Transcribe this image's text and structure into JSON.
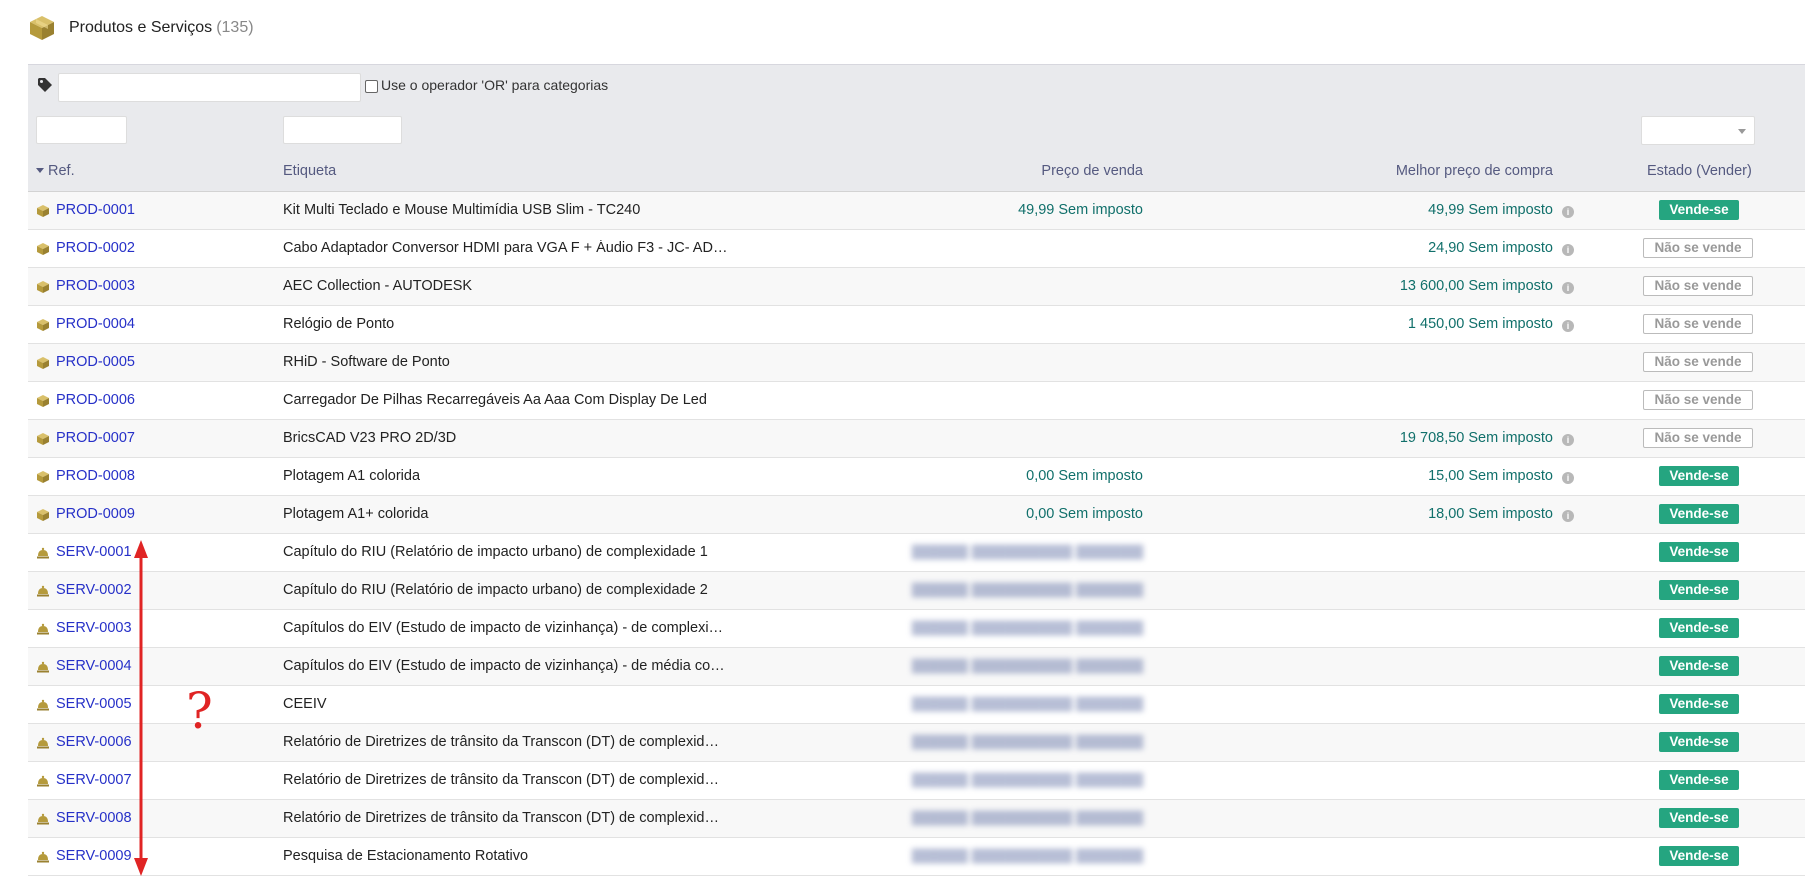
{
  "header": {
    "title": "Produtos e Serviços",
    "count": "(135)"
  },
  "filters": {
    "or_label": "Use o operador 'OR' para categorias",
    "tag_value": "",
    "ref_value": "",
    "label_value": "",
    "status_value": ""
  },
  "columns": {
    "ref": "Ref.",
    "label": "Etiqueta",
    "sell_price": "Preço de venda",
    "best_buy_price": "Melhor preço de compra",
    "status": "Estado (Vender)"
  },
  "rows": [
    {
      "type": "product",
      "ref": "PROD-0001",
      "label": "Kit Multi Teclado e Mouse Multimídia USB Slim - TC240",
      "price": "49,99 Sem imposto",
      "buy": "49,99 Sem imposto",
      "status": "Vende-se",
      "sells": true
    },
    {
      "type": "product",
      "ref": "PROD-0002",
      "label": "Cabo Adaptador Conversor HDMI para VGA F + Áudio F3 - JC- AD…",
      "price": "",
      "buy": "24,90 Sem imposto",
      "status": "Não se vende",
      "sells": false
    },
    {
      "type": "product",
      "ref": "PROD-0003",
      "label": "AEC Collection - AUTODESK",
      "price": "",
      "buy": "13 600,00 Sem imposto",
      "status": "Não se vende",
      "sells": false
    },
    {
      "type": "product",
      "ref": "PROD-0004",
      "label": "Relógio de Ponto",
      "price": "",
      "buy": "1 450,00 Sem imposto",
      "status": "Não se vende",
      "sells": false
    },
    {
      "type": "product",
      "ref": "PROD-0005",
      "label": "RHiD - Software de Ponto",
      "price": "",
      "buy": "",
      "status": "Não se vende",
      "sells": false
    },
    {
      "type": "product",
      "ref": "PROD-0006",
      "label": "Carregador De Pilhas Recarregáveis Aa Aaa Com Display De Led",
      "price": "",
      "buy": "",
      "status": "Não se vende",
      "sells": false
    },
    {
      "type": "product",
      "ref": "PROD-0007",
      "label": "BricsCAD V23 PRO 2D/3D",
      "price": "",
      "buy": "19 708,50 Sem imposto",
      "status": "Não se vende",
      "sells": false
    },
    {
      "type": "product",
      "ref": "PROD-0008",
      "label": "Plotagem A1 colorida",
      "price": "0,00 Sem imposto",
      "buy": "15,00 Sem imposto",
      "status": "Vende-se",
      "sells": true
    },
    {
      "type": "product",
      "ref": "PROD-0009",
      "label": "Plotagem A1+ colorida",
      "price": "0,00 Sem imposto",
      "buy": "18,00 Sem imposto",
      "status": "Vende-se",
      "sells": true
    },
    {
      "type": "service",
      "ref": "SERV-0001",
      "label": "Capítulo do RIU (Relatório de impacto urbano) de complexidade 1",
      "price": "",
      "blurred": true,
      "buy": "",
      "status": "Vende-se",
      "sells": true
    },
    {
      "type": "service",
      "ref": "SERV-0002",
      "label": "Capítulo do RIU (Relatório de impacto urbano) de complexidade 2",
      "price": "",
      "blurred": true,
      "buy": "",
      "status": "Vende-se",
      "sells": true
    },
    {
      "type": "service",
      "ref": "SERV-0003",
      "label": "Capítulos do EIV (Estudo de impacto de vizinhança) - de complexi…",
      "price": "",
      "blurred": true,
      "buy": "",
      "status": "Vende-se",
      "sells": true
    },
    {
      "type": "service",
      "ref": "SERV-0004",
      "label": "Capítulos do EIV (Estudo de impacto de vizinhança) - de média co…",
      "price": "",
      "blurred": true,
      "buy": "",
      "status": "Vende-se",
      "sells": true
    },
    {
      "type": "service",
      "ref": "SERV-0005",
      "label": "CEEIV",
      "price": "",
      "blurred": true,
      "buy": "",
      "status": "Vende-se",
      "sells": true
    },
    {
      "type": "service",
      "ref": "SERV-0006",
      "label": "Relatório de Diretrizes de trânsito da Transcon (DT) de complexid…",
      "price": "",
      "blurred": true,
      "buy": "",
      "status": "Vende-se",
      "sells": true
    },
    {
      "type": "service",
      "ref": "SERV-0007",
      "label": "Relatório de Diretrizes de trânsito da Transcon (DT) de complexid…",
      "price": "",
      "blurred": true,
      "buy": "",
      "status": "Vende-se",
      "sells": true
    },
    {
      "type": "service",
      "ref": "SERV-0008",
      "label": "Relatório de Diretrizes de trânsito da Transcon (DT) de complexid…",
      "price": "",
      "blurred": true,
      "buy": "",
      "status": "Vende-se",
      "sells": true
    },
    {
      "type": "service",
      "ref": "SERV-0009",
      "label": "Pesquisa de Estacionamento Rotativo",
      "price": "",
      "blurred": true,
      "buy": "",
      "status": "Vende-se",
      "sells": true
    }
  ],
  "annotation": {
    "mark": "?",
    "color": "#e02424"
  },
  "colors": {
    "sell_badge": "#25a580",
    "price_text": "#11706b",
    "ref_link": "#2630c8",
    "icon_gold": "#b59a3c"
  }
}
